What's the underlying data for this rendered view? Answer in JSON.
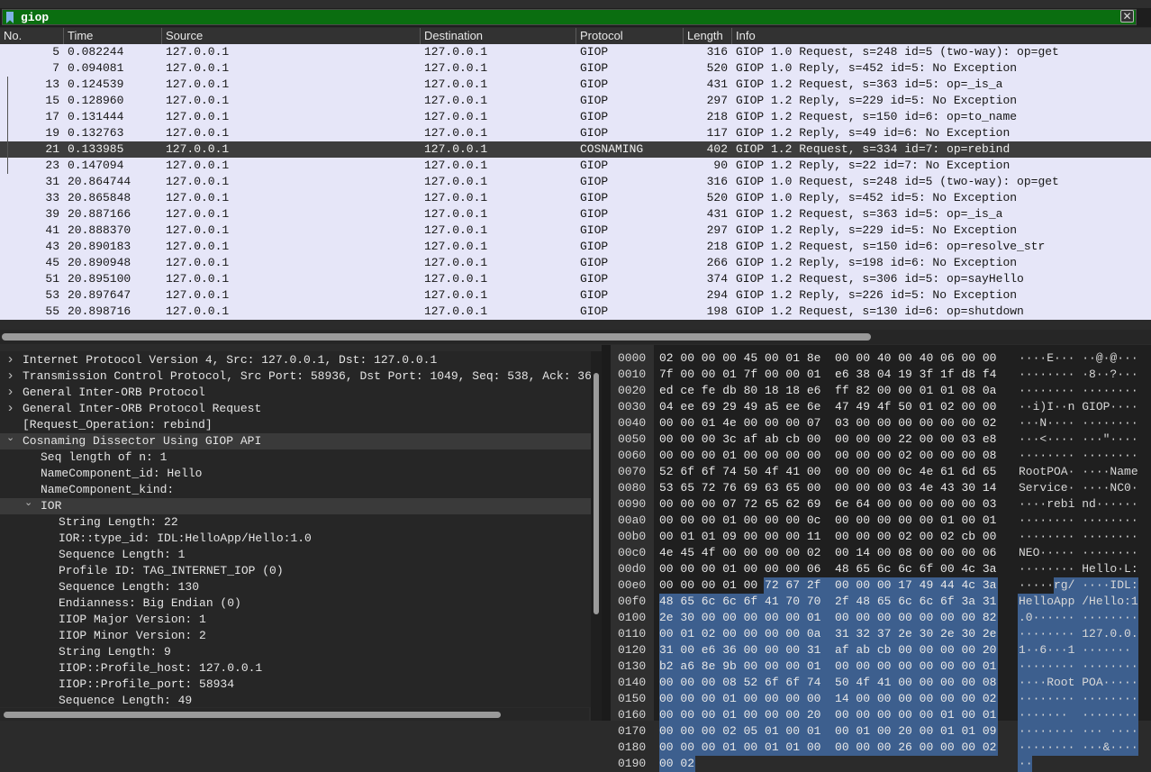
{
  "filter": {
    "value": "giop"
  },
  "packet_list": {
    "columns": [
      "No.",
      "Time",
      "Source",
      "Destination",
      "Protocol",
      "Length",
      "Info"
    ],
    "rows": [
      {
        "no": "5",
        "time": "0.082244",
        "src": "127.0.0.1",
        "dst": "127.0.0.1",
        "proto": "GIOP",
        "len": "316",
        "info": "GIOP 1.0 Request, s=248 id=5 (two-way): op=get"
      },
      {
        "no": "7",
        "time": "0.094081",
        "src": "127.0.0.1",
        "dst": "127.0.0.1",
        "proto": "GIOP",
        "len": "520",
        "info": "GIOP 1.0 Reply, s=452 id=5: No Exception"
      },
      {
        "no": "13",
        "time": "0.124539",
        "src": "127.0.0.1",
        "dst": "127.0.0.1",
        "proto": "GIOP",
        "len": "431",
        "info": "GIOP 1.2 Request, s=363 id=5: op=_is_a"
      },
      {
        "no": "15",
        "time": "0.128960",
        "src": "127.0.0.1",
        "dst": "127.0.0.1",
        "proto": "GIOP",
        "len": "297",
        "info": "GIOP 1.2 Reply, s=229 id=5: No Exception"
      },
      {
        "no": "17",
        "time": "0.131444",
        "src": "127.0.0.1",
        "dst": "127.0.0.1",
        "proto": "GIOP",
        "len": "218",
        "info": "GIOP 1.2 Request, s=150 id=6: op=to_name"
      },
      {
        "no": "19",
        "time": "0.132763",
        "src": "127.0.0.1",
        "dst": "127.0.0.1",
        "proto": "GIOP",
        "len": "117",
        "info": "GIOP 1.2 Reply, s=49 id=6: No Exception"
      },
      {
        "no": "21",
        "time": "0.133985",
        "src": "127.0.0.1",
        "dst": "127.0.0.1",
        "proto": "COSNAMING",
        "len": "402",
        "info": "GIOP 1.2 Request, s=334 id=7: op=rebind"
      },
      {
        "no": "23",
        "time": "0.147094",
        "src": "127.0.0.1",
        "dst": "127.0.0.1",
        "proto": "GIOP",
        "len": "90",
        "info": "GIOP 1.2 Reply, s=22 id=7: No Exception"
      },
      {
        "no": "31",
        "time": "20.864744",
        "src": "127.0.0.1",
        "dst": "127.0.0.1",
        "proto": "GIOP",
        "len": "316",
        "info": "GIOP 1.0 Request, s=248 id=5 (two-way): op=get"
      },
      {
        "no": "33",
        "time": "20.865848",
        "src": "127.0.0.1",
        "dst": "127.0.0.1",
        "proto": "GIOP",
        "len": "520",
        "info": "GIOP 1.0 Reply, s=452 id=5: No Exception"
      },
      {
        "no": "39",
        "time": "20.887166",
        "src": "127.0.0.1",
        "dst": "127.0.0.1",
        "proto": "GIOP",
        "len": "431",
        "info": "GIOP 1.2 Request, s=363 id=5: op=_is_a"
      },
      {
        "no": "41",
        "time": "20.888370",
        "src": "127.0.0.1",
        "dst": "127.0.0.1",
        "proto": "GIOP",
        "len": "297",
        "info": "GIOP 1.2 Reply, s=229 id=5: No Exception"
      },
      {
        "no": "43",
        "time": "20.890183",
        "src": "127.0.0.1",
        "dst": "127.0.0.1",
        "proto": "GIOP",
        "len": "218",
        "info": "GIOP 1.2 Request, s=150 id=6: op=resolve_str"
      },
      {
        "no": "45",
        "time": "20.890948",
        "src": "127.0.0.1",
        "dst": "127.0.0.1",
        "proto": "GIOP",
        "len": "266",
        "info": "GIOP 1.2 Reply, s=198 id=6: No Exception"
      },
      {
        "no": "51",
        "time": "20.895100",
        "src": "127.0.0.1",
        "dst": "127.0.0.1",
        "proto": "GIOP",
        "len": "374",
        "info": "GIOP 1.2 Request, s=306 id=5: op=sayHello"
      },
      {
        "no": "53",
        "time": "20.897647",
        "src": "127.0.0.1",
        "dst": "127.0.0.1",
        "proto": "GIOP",
        "len": "294",
        "info": "GIOP 1.2 Reply, s=226 id=5: No Exception"
      },
      {
        "no": "55",
        "time": "20.898716",
        "src": "127.0.0.1",
        "dst": "127.0.0.1",
        "proto": "GIOP",
        "len": "198",
        "info": "GIOP 1.2 Request, s=130 id=6: op=shutdown"
      }
    ],
    "selected_no": "21"
  },
  "details": [
    {
      "text": "Internet Protocol Version 4, Src: 127.0.0.1, Dst: 127.0.0.1",
      "arrow": "collapsed",
      "level": 0
    },
    {
      "text": "Transmission Control Protocol, Src Port: 58936, Dst Port: 1049, Seq: 538, Ack: 36",
      "arrow": "collapsed",
      "level": 0
    },
    {
      "text": "General Inter-ORB Protocol",
      "arrow": "collapsed",
      "level": 0
    },
    {
      "text": "General Inter-ORB Protocol Request",
      "arrow": "collapsed",
      "level": 0
    },
    {
      "text": "[Request_Operation: rebind]",
      "arrow": "none",
      "level": 0
    },
    {
      "text": "Cosnaming Dissector Using GIOP API",
      "arrow": "expanded",
      "level": 0
    },
    {
      "text": "Seq length of n: 1",
      "arrow": "none",
      "level": 1
    },
    {
      "text": "NameComponent_id: Hello",
      "arrow": "none",
      "level": 1
    },
    {
      "text": "NameComponent_kind:",
      "arrow": "none",
      "level": 1
    },
    {
      "text": "IOR",
      "arrow": "expanded",
      "level": 1
    },
    {
      "text": "String Length: 22",
      "arrow": "none",
      "level": 2
    },
    {
      "text": "IOR::type_id: IDL:HelloApp/Hello:1.0",
      "arrow": "none",
      "level": 2
    },
    {
      "text": "Sequence Length: 1",
      "arrow": "none",
      "level": 2
    },
    {
      "text": "Profile ID: TAG_INTERNET_IOP (0)",
      "arrow": "none",
      "level": 2
    },
    {
      "text": "Sequence Length: 130",
      "arrow": "none",
      "level": 2
    },
    {
      "text": "Endianness: Big Endian (0)",
      "arrow": "none",
      "level": 2
    },
    {
      "text": "IIOP Major Version: 1",
      "arrow": "none",
      "level": 2
    },
    {
      "text": "IIOP Minor Version: 2",
      "arrow": "none",
      "level": 2
    },
    {
      "text": "String Length: 9",
      "arrow": "none",
      "level": 2
    },
    {
      "text": "IIOP::Profile_host: 127.0.0.1",
      "arrow": "none",
      "level": 2
    },
    {
      "text": "IIOP::Profile_port: 58934",
      "arrow": "none",
      "level": 2
    },
    {
      "text": "Sequence Length: 49",
      "arrow": "none",
      "level": 2
    }
  ],
  "hex": [
    {
      "off": "0000",
      "bytes": "02 00 00 00 45 00 01 8e  00 00 40 00 40 06 00 00",
      "ascii": "····E··· ··@·@···"
    },
    {
      "off": "0010",
      "bytes": "7f 00 00 01 7f 00 00 01  e6 38 04 19 3f 1f d8 f4",
      "ascii": "········ ·8··?···"
    },
    {
      "off": "0020",
      "bytes": "ed ce fe db 80 18 18 e6  ff 82 00 00 01 01 08 0a",
      "ascii": "········ ········"
    },
    {
      "off": "0030",
      "bytes": "04 ee 69 29 49 a5 ee 6e  47 49 4f 50 01 02 00 00",
      "ascii": "··i)I··n GIOP····"
    },
    {
      "off": "0040",
      "bytes": "00 00 01 4e 00 00 00 07  03 00 00 00 00 00 00 02",
      "ascii": "···N···· ········"
    },
    {
      "off": "0050",
      "bytes": "00 00 00 3c af ab cb 00  00 00 00 22 00 00 03 e8",
      "ascii": "···<···· ···\"····"
    },
    {
      "off": "0060",
      "bytes": "00 00 00 01 00 00 00 00  00 00 00 02 00 00 00 08",
      "ascii": "········ ········"
    },
    {
      "off": "0070",
      "bytes": "52 6f 6f 74 50 4f 41 00  00 00 00 0c 4e 61 6d 65",
      "ascii": "RootPOA· ····Name"
    },
    {
      "off": "0080",
      "bytes": "53 65 72 76 69 63 65 00  00 00 00 03 4e 43 30 14",
      "ascii": "Service· ····NC0·"
    },
    {
      "off": "0090",
      "bytes": "00 00 00 07 72 65 62 69  6e 64 00 00 00 00 00 03",
      "ascii": "····rebi nd······"
    },
    {
      "off": "00a0",
      "bytes": "00 00 00 01 00 00 00 0c  00 00 00 00 00 01 00 01",
      "ascii": "········ ········"
    },
    {
      "off": "00b0",
      "bytes": "00 01 01 09 00 00 00 11  00 00 00 02 00 02 cb 00",
      "ascii": "········ ········"
    },
    {
      "off": "00c0",
      "bytes": "4e 45 4f 00 00 00 00 02  00 14 00 08 00 00 00 06",
      "ascii": "NEO····· ········"
    },
    {
      "off": "00d0",
      "bytes": "00 00 00 01 00 00 00 06  48 65 6c 6c 6f 00 4c 3a",
      "ascii": "········ Hello·L:"
    },
    {
      "off": "00e0",
      "bytes": "00 00 00 01 00 72 67 2f  00 00 00 17 49 44 4c 3a",
      "ascii": "·····rg/ ····IDL:"
    },
    {
      "off": "00f0",
      "bytes": "48 65 6c 6c 6f 41 70 70  2f 48 65 6c 6c 6f 3a 31",
      "ascii": "HelloApp /Hello:1"
    },
    {
      "off": "0100",
      "bytes": "2e 30 00 00 00 00 00 01  00 00 00 00 00 00 00 82",
      "ascii": ".0······ ········"
    },
    {
      "off": "0110",
      "bytes": "00 01 02 00 00 00 00 0a  31 32 37 2e 30 2e 30 2e",
      "ascii": "········ 127.0.0."
    },
    {
      "off": "0120",
      "bytes": "31 00 e6 36 00 00 00 31  af ab cb 00 00 00 00 20",
      "ascii": "1··6···1 ·······"
    },
    {
      "off": "0130",
      "bytes": "b2 a6 8e 9b 00 00 00 01  00 00 00 00 00 00 00 01",
      "ascii": "········ ········"
    },
    {
      "off": "0140",
      "bytes": "00 00 00 08 52 6f 6f 74  50 4f 41 00 00 00 00 08",
      "ascii": "····Root POA·····"
    },
    {
      "off": "0150",
      "bytes": "00 00 00 01 00 00 00 00  14 00 00 00 00 00 00 02",
      "ascii": "········ ········"
    },
    {
      "off": "0160",
      "bytes": "00 00 00 01 00 00 00 20  00 00 00 00 00 01 00 01",
      "ascii": "·······  ········"
    },
    {
      "off": "0170",
      "bytes": "00 00 00 02 05 01 00 01  00 01 00 20 00 01 01 09",
      "ascii": "········ ··· ····"
    },
    {
      "off": "0180",
      "bytes": "00 00 00 01 00 01 01 00  00 00 00 26 00 00 00 02",
      "ascii": "········ ···&····"
    },
    {
      "off": "0190",
      "bytes": "00 02",
      "ascii": "··"
    }
  ],
  "colors": {
    "row_bg": "#e6e6f8",
    "selected_bg": "#3d3d3d",
    "filter_bg": "#0a6e10",
    "hex_highlight": "#3d5f8e"
  },
  "icons": {
    "filter": "bookmark-icon",
    "clear": "close-icon",
    "collapsed": "chevron-right-icon",
    "expanded": "chevron-down-icon"
  }
}
